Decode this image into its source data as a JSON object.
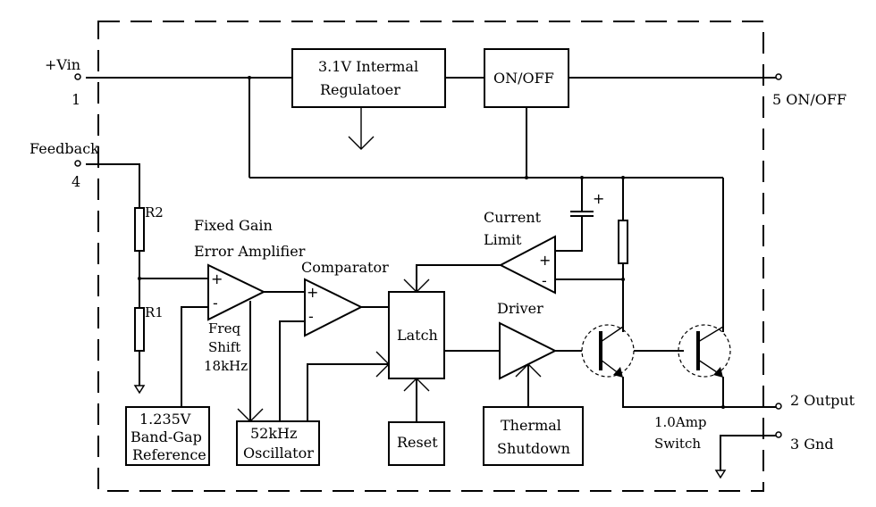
{
  "diagram": {
    "pins": {
      "vin_label": "+Vin",
      "vin_number": "1",
      "feedback_label": "Feedback",
      "feedback_number": "4",
      "onoff_label": "5 ON/OFF",
      "output_label": "2 Output",
      "gnd_label": "3 Gnd"
    },
    "blocks": {
      "regulator_line1": "3.1V Intermal",
      "regulator_line2": "Regulatoer",
      "onoff": "ON/OFF",
      "latch": "Latch",
      "reset": "Reset",
      "thermal_line1": "Thermal",
      "thermal_line2": "Shutdown",
      "bandgap_line1": "1.235V",
      "bandgap_line2": "Band-Gap",
      "bandgap_line3": "Reference",
      "osc_line1": "52kHz",
      "osc_line2": "Oscillator"
    },
    "labels": {
      "r2": "R2",
      "r1": "R1",
      "error_amp_line1": "Fixed Gain",
      "error_amp_line2": "Error Amplifier",
      "comparator": "Comparator",
      "current_limit_line1": "Current",
      "current_limit_line2": "Limit",
      "driver": "Driver",
      "freq_line1": "Freq",
      "freq_line2": "Shift",
      "freq_line3": "18kHz",
      "switch_line1": "1.0Amp",
      "switch_line2": "Switch",
      "plus": "+",
      "minus": "-",
      "cap_plus": "+"
    }
  }
}
